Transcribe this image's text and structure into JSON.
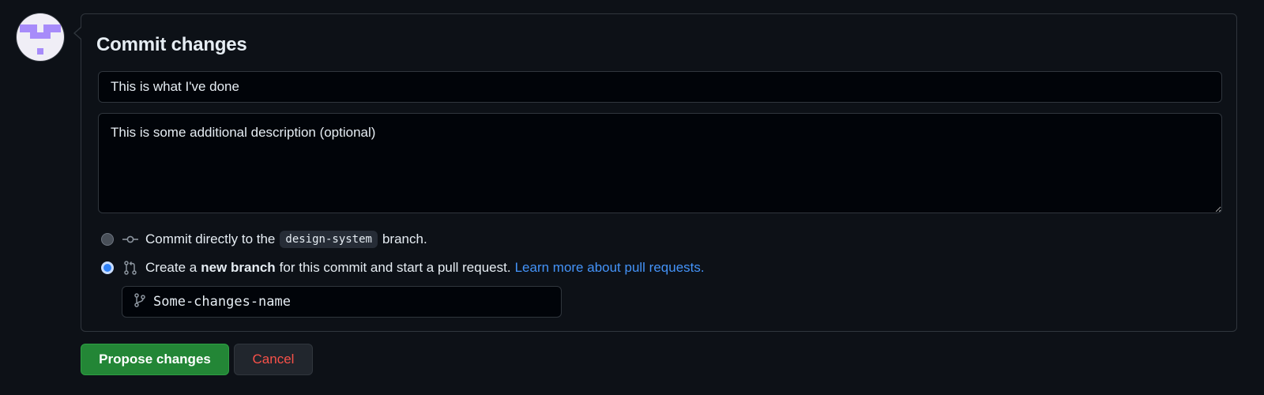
{
  "user": {
    "avatar_icon": "identicon-avatar",
    "avatar_color": "#a78bfa"
  },
  "commit": {
    "title": "Commit changes",
    "summary_value": "This is what I've done",
    "description_value": "This is some additional description (optional)"
  },
  "options": {
    "direct": {
      "selected": false,
      "icon": "git-commit-icon",
      "prefix": "Commit directly to the",
      "branch": "design-system",
      "suffix": "branch."
    },
    "new_branch": {
      "selected": true,
      "icon": "git-pull-request-icon",
      "prefix": "Create a",
      "strong": "new branch",
      "suffix": "for this commit and start a pull request.",
      "link": "Learn more about pull requests."
    }
  },
  "branch_input": {
    "icon": "git-branch-icon",
    "value": "Some-changes-name"
  },
  "actions": {
    "propose_label": "Propose changes",
    "cancel_label": "Cancel"
  },
  "colors": {
    "background": "#0d1117",
    "border": "#30363d",
    "primary": "#238636",
    "danger": "#f85149",
    "link": "#4493f8"
  }
}
